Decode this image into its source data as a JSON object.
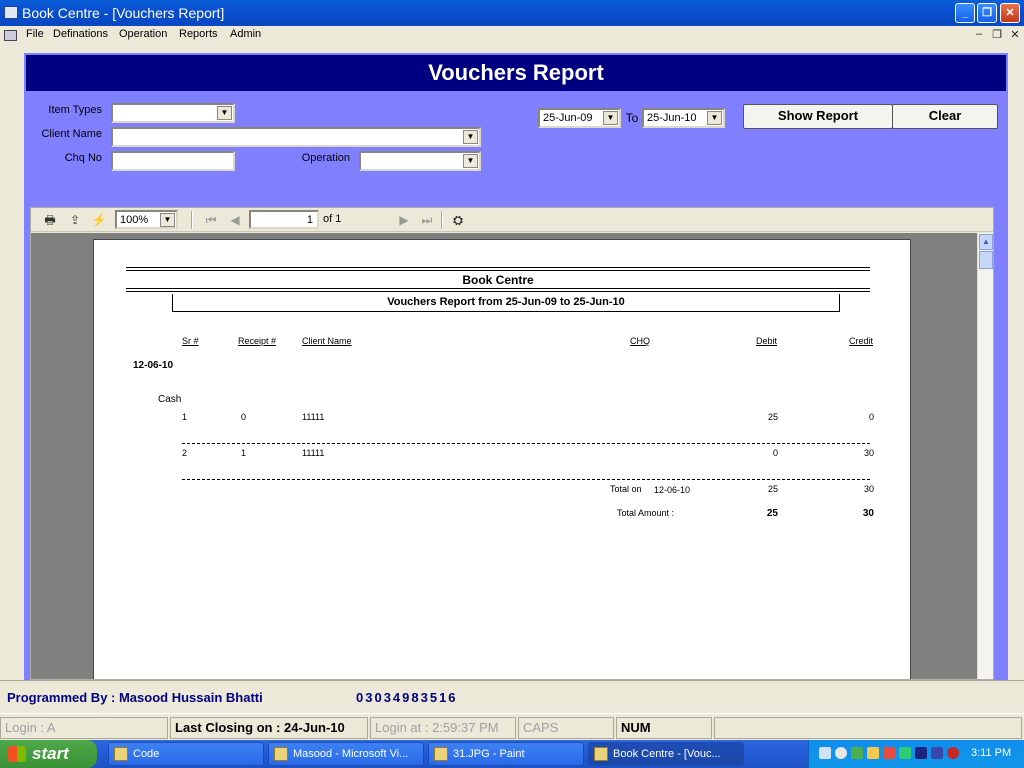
{
  "window": {
    "title": "Book Centre  - [Vouchers Report]"
  },
  "menu": [
    "File",
    "Definations",
    "Operation",
    "Reports",
    "Admin"
  ],
  "form": {
    "banner": "Vouchers Report",
    "item_types_label": "Item Types",
    "client_name_label": "Client Name",
    "chq_no_label": "Chq No",
    "operation_label": "Operation",
    "date_from": "25-Jun-09",
    "to_label": "To",
    "date_to": "25-Jun-10",
    "show_report": "Show Report",
    "clear": "Clear"
  },
  "viewer": {
    "zoom": "100%",
    "page": "1",
    "of_pages": "of 1"
  },
  "report": {
    "company": "Book Centre",
    "subtitle": "Vouchers Report from 25-Jun-09 to 25-Jun-10",
    "columns": {
      "sr": "Sr #",
      "receipt": "Receipt #",
      "client": "Client Name",
      "chq": "CHQ",
      "debit": "Debit",
      "credit": "Credit"
    },
    "group_date": "12-06-10",
    "subgroup": "Cash",
    "rows": [
      {
        "sr": "1",
        "receipt": "0",
        "client": "11111",
        "debit": "25",
        "credit": "0"
      },
      {
        "sr": "2",
        "receipt": "1",
        "client": "11111",
        "debit": "0",
        "credit": "30"
      }
    ],
    "total_on_label": "Total on",
    "total_on_date": "12-06-10",
    "total_on_debit": "25",
    "total_on_credit": "30",
    "total_amount_label": "Total Amount :",
    "total_amount_debit": "25",
    "total_amount_credit": "30"
  },
  "footer": {
    "programmer": "Programmed By : Masood Hussain Bhatti",
    "phone": "03034983516"
  },
  "status": {
    "login": "Login :  A",
    "last_closing": "Last Closing on : 24-Jun-10",
    "login_at": "Login at : 2:59:37 PM",
    "caps": "CAPS",
    "num": "NUM"
  },
  "taskbar": {
    "start": "start",
    "tasks": [
      "Code",
      "Masood - Microsoft Vi...",
      "31.JPG - Paint",
      "Book Centre  - [Vouc..."
    ],
    "clock": "3:11 PM"
  }
}
